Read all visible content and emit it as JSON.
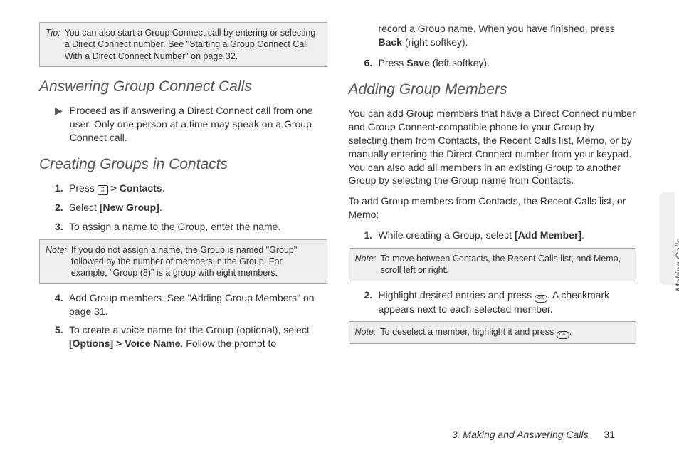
{
  "side_tab": "Making Calls",
  "footer": {
    "section": "3. Making and Answering Calls",
    "page": "31"
  },
  "left": {
    "tip_label": "Tip:",
    "tip_text": "You can also start a Group Connect call by entering or selecting a Direct Connect number. See \"Starting a Group Connect Call With a Direct Connect Number\" on page 32.",
    "h_answering": "Answering Group Connect Calls",
    "answering_bullet": "Proceed as if answering a Direct Connect call from one user. Only one person at a time may speak on a Group Connect call.",
    "h_creating": "Creating Groups in Contacts",
    "step1_a": "Press ",
    "step1_b": " > ",
    "step1_c": "Contacts",
    "step1_d": ".",
    "step2_a": "Select ",
    "step2_b": "[New Group]",
    "step2_c": ".",
    "step3": "To assign a name to the Group, enter the name.",
    "note1_label": "Note:",
    "note1_text": "If you do not assign a name, the Group is named \"Group\" followed by the number of members in the Group. For example, \"Group (8)\" is a group with eight members.",
    "step4": "Add Group members. See \"Adding Group Members\" on page 31.",
    "step5_a": "To create a voice name for the Group (optional), select ",
    "step5_b": "[Options]",
    "step5_c": " > ",
    "step5_d": "Voice Name",
    "step5_e": ". Follow the prompt to"
  },
  "right": {
    "cont_a": "record a Group name. When you have finished, press ",
    "cont_b": "Back",
    "cont_c": " (right softkey).",
    "step6_a": "Press ",
    "step6_b": "Save",
    "step6_c": " (left softkey).",
    "h_adding": "Adding Group Members",
    "adding_para": "You can add Group members that have a Direct Connect number and Group Connect-compatible phone to your Group by selecting them from Contacts, the Recent Calls list, Memo, or by manually entering the Direct Connect number from your keypad. You can also add all members in an existing Group to another Group by selecting the Group name from Contacts.",
    "lead": "To add Group members from Contacts, the Recent Calls list, or Memo:",
    "r_step1_a": "While creating a Group, select ",
    "r_step1_b": "[Add Member]",
    "r_step1_c": ".",
    "note2_label": "Note:",
    "note2_text": "To move between Contacts, the Recent Calls list, and Memo, scroll left or right.",
    "r_step2_a": "Highlight desired entries and press ",
    "r_step2_b": ". A checkmark appears next to each selected member.",
    "note3_label": "Note:",
    "note3_text_a": "To deselect a member, highlight it and press ",
    "note3_text_b": "."
  }
}
